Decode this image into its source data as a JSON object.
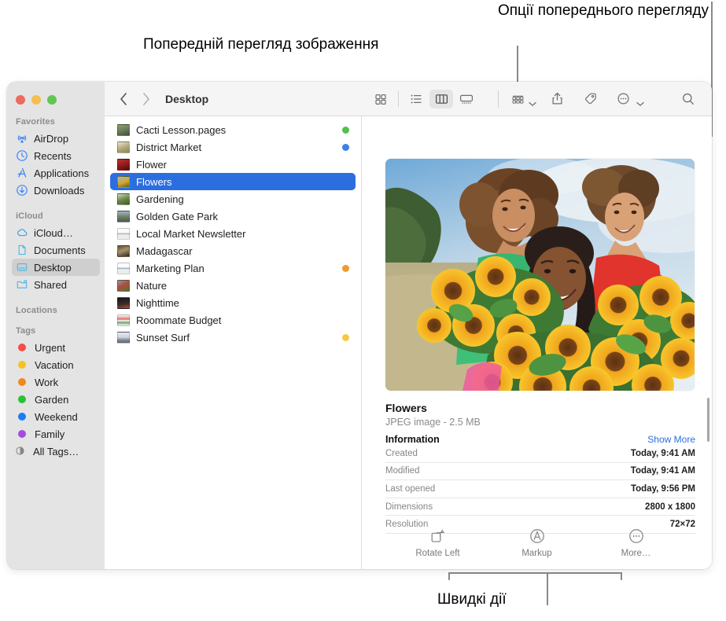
{
  "annotations": {
    "preview_options": "Опції попереднього перегляду",
    "image_preview": "Попередній перегляд зображення",
    "quick_actions": "Швидкі дії"
  },
  "window": {
    "traffic_lights": {
      "close": "#ec6a5f",
      "minimize": "#f5bf4f",
      "zoom": "#61c555"
    }
  },
  "toolbar": {
    "back_label": "Back",
    "forward_label": "Forward",
    "path_title": "Desktop",
    "view_icon_label": "Icon view",
    "view_list_label": "List view",
    "view_column_label": "Column view",
    "view_gallery_label": "Gallery view",
    "group_label": "Group items",
    "share_label": "Share",
    "tags_label": "Tags",
    "action_label": "More actions",
    "search_label": "Search"
  },
  "sidebar": {
    "groups": [
      {
        "header": "Favorites",
        "items": [
          {
            "label": "AirDrop",
            "icon": "airdrop-icon",
            "selected": false
          },
          {
            "label": "Recents",
            "icon": "clock-icon",
            "selected": false
          },
          {
            "label": "Applications",
            "icon": "applications-icon",
            "selected": false
          },
          {
            "label": "Downloads",
            "icon": "downloads-icon",
            "selected": false
          }
        ]
      },
      {
        "header": "iCloud",
        "items": [
          {
            "label": "iCloud…",
            "icon": "cloud-icon",
            "selected": false
          },
          {
            "label": "Documents",
            "icon": "document-icon",
            "selected": false
          },
          {
            "label": "Desktop",
            "icon": "desktop-icon",
            "selected": true
          },
          {
            "label": "Shared",
            "icon": "shared-folder-icon",
            "selected": false
          }
        ]
      },
      {
        "header": "Locations",
        "items": []
      },
      {
        "header": "Tags",
        "items": [
          {
            "label": "Urgent",
            "color": "#f84c43"
          },
          {
            "label": "Vacation",
            "color": "#f6c224"
          },
          {
            "label": "Work",
            "color": "#ef8a1c"
          },
          {
            "label": "Garden",
            "color": "#2cc038"
          },
          {
            "label": "Weekend",
            "color": "#1b7df4"
          },
          {
            "label": "Family",
            "color": "#a44ce0"
          },
          {
            "label": "All Tags…",
            "color": null,
            "icon": "all-tags-icon"
          }
        ]
      }
    ]
  },
  "file_list": {
    "items": [
      {
        "name": "Cacti Lesson.pages",
        "tag": "#4fc14d",
        "selected": false,
        "thumb": [
          "#6d7f5a",
          "#8fa06c",
          "#3d5238"
        ]
      },
      {
        "name": "District Market",
        "tag": "#3b82e8",
        "selected": false,
        "thumb": [
          "#e8e4d8",
          "#b9a97a",
          "#7d8f5e"
        ]
      },
      {
        "name": "Flower",
        "tag": null,
        "selected": false,
        "thumb": [
          "#8c1a1a",
          "#c03030",
          "#4a0f0f"
        ]
      },
      {
        "name": "Flowers",
        "tag": null,
        "selected": true,
        "thumb": [
          "#8fbad8",
          "#e0a52a",
          "#3f6b2d"
        ]
      },
      {
        "name": "Gardening",
        "tag": null,
        "selected": false,
        "thumb": [
          "#cfd8c0",
          "#6c8a4a",
          "#3e5a2c"
        ]
      },
      {
        "name": "Golden Gate Park",
        "tag": null,
        "selected": false,
        "thumb": [
          "#9fb6c6",
          "#6d7d63",
          "#4c5a46"
        ]
      },
      {
        "name": "Local Market Newsletter",
        "tag": null,
        "selected": false,
        "thumb": [
          "#f2f2f2",
          "#9fb4c4",
          "#e4e4e4"
        ]
      },
      {
        "name": "Madagascar",
        "tag": null,
        "selected": false,
        "thumb": [
          "#2f2a22",
          "#a8936a",
          "#5b4e34"
        ]
      },
      {
        "name": "Marketing Plan",
        "tag": "#ef9a32",
        "selected": false,
        "thumb": [
          "#f2f2f2",
          "#8fb0c8",
          "#e4e4e4"
        ]
      },
      {
        "name": "Nature",
        "tag": null,
        "selected": false,
        "thumb": [
          "#7fa0c0",
          "#4c7a35",
          "#b34a3a"
        ]
      },
      {
        "name": "Nighttime",
        "tag": null,
        "selected": false,
        "thumb": [
          "#17161c",
          "#3a2f2a",
          "#c24b28"
        ]
      },
      {
        "name": "Roommate Budget",
        "tag": null,
        "selected": false,
        "thumb": [
          "#f6f6f6",
          "#e27070",
          "#6fa86f"
        ]
      },
      {
        "name": "Sunset Surf",
        "tag": "#f6c945",
        "selected": false,
        "thumb": [
          "#cfd6dc",
          "#8a93a0",
          "#5a6270"
        ]
      }
    ]
  },
  "preview": {
    "image_alt": "Three smiling women holding large bouquets of sunflowers in a sunny field",
    "title": "Flowers",
    "subtitle": "JPEG image - 2.5 MB",
    "info_header": "Information",
    "show_more": "Show More",
    "rows": [
      {
        "key": "Created",
        "value": "Today, 9:41 AM"
      },
      {
        "key": "Modified",
        "value": "Today, 9:41 AM"
      },
      {
        "key": "Last opened",
        "value": "Today, 9:56 PM"
      },
      {
        "key": "Dimensions",
        "value": "2800 x 1800"
      },
      {
        "key": "Resolution",
        "value": "72×72"
      }
    ]
  },
  "quick_actions": {
    "items": [
      {
        "label": "Rotate Left",
        "icon": "rotate-left-icon"
      },
      {
        "label": "Markup",
        "icon": "markup-icon"
      },
      {
        "label": "More…",
        "icon": "more-icon"
      }
    ]
  }
}
